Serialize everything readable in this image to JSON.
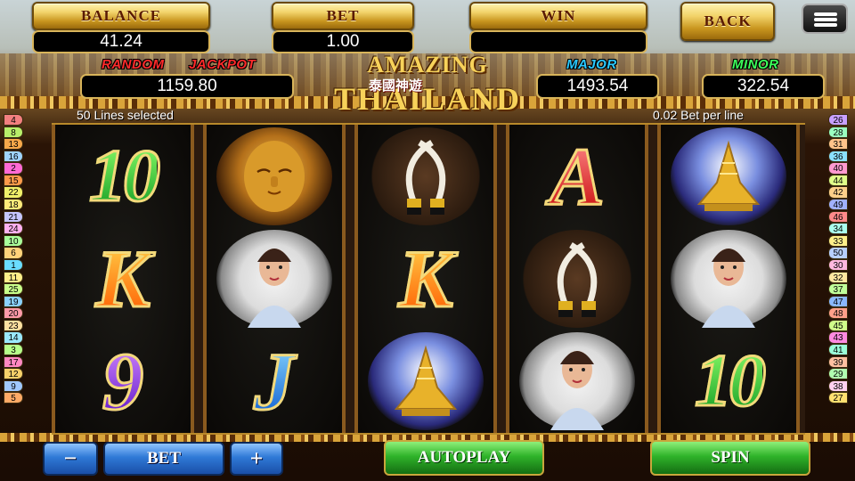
{
  "header": {
    "balance_label": "BALANCE",
    "balance_value": "41.24",
    "bet_label": "BET",
    "bet_value": "1.00",
    "win_label": "WIN",
    "win_value": "",
    "back_label": "BACK"
  },
  "jackpots": {
    "random_label_1": "RANDOM",
    "random_label_2": "JACKPOT",
    "random_value": "1159.80",
    "major_label": "MAJOR",
    "major_value": "1493.54",
    "minor_label": "MINOR",
    "minor_value": "322.54"
  },
  "title": {
    "line1": "AMAZING",
    "chinese": "泰國神遊",
    "line2": "THAILAND"
  },
  "info": {
    "lines_selected": "50 Lines selected",
    "bet_per_line": "0.02 Bet per line"
  },
  "colors": {
    "gold": "#f2d36a",
    "red_label": "#ff2a2a",
    "cyan_label": "#29c9ff",
    "green_label": "#3cff5a"
  },
  "paylines": {
    "left": [
      "4",
      "8",
      "13",
      "16",
      "2",
      "15",
      "22",
      "18",
      "21",
      "24",
      "10",
      "6",
      "1",
      "11",
      "25",
      "19",
      "20",
      "23",
      "14",
      "3",
      "17",
      "12",
      "9",
      "5"
    ],
    "right": [
      "26",
      "28",
      "31",
      "36",
      "40",
      "44",
      "42",
      "49",
      "46",
      "34",
      "33",
      "50",
      "30",
      "32",
      "37",
      "47",
      "48",
      "45",
      "43",
      "41",
      "39",
      "29",
      "38",
      "27"
    ],
    "left_colors": [
      "#f27f7f",
      "#b8ef6a",
      "#f7a84a",
      "#9fd3ff",
      "#ff6ad5",
      "#ff9a4a",
      "#f0f06a",
      "#ffe97a",
      "#c6c6ff",
      "#ffb0f0",
      "#a9ff9a",
      "#ffd27a",
      "#6adcff",
      "#ffef8a",
      "#c9ff8a",
      "#8ad1ff",
      "#ff9aa8",
      "#ffe0a0",
      "#9ae8ff",
      "#b6ff8a",
      "#ff88c2",
      "#f7d06a",
      "#a0c8ff",
      "#ffaa66"
    ],
    "right_colors": [
      "#c8a0ff",
      "#9affc0",
      "#ffc38a",
      "#8ae0ff",
      "#ff9ad0",
      "#e0ff8a",
      "#ffd08a",
      "#a0b0ff",
      "#ff8a8a",
      "#aaffee",
      "#fff08a",
      "#b8d0ff",
      "#ffb8e0",
      "#ffe8a0",
      "#c0ff9a",
      "#8ab8ff",
      "#ffa08a",
      "#d0ff8a",
      "#ff8ae0",
      "#9affd8",
      "#ffc0a0",
      "#b0ffb0",
      "#ffd0f0",
      "#ffe070"
    ]
  },
  "reels": [
    [
      "ten",
      "king",
      "nine"
    ],
    [
      "buddha",
      "dancer",
      "jack"
    ],
    [
      "tusks",
      "king",
      "pagoda"
    ],
    [
      "ace",
      "tusks",
      "dancer"
    ],
    [
      "pagoda",
      "dancer",
      "ten"
    ]
  ],
  "symbols": {
    "ten": "10",
    "king": "K",
    "nine": "9",
    "jack": "J",
    "ace": "A"
  },
  "controls": {
    "minus": "−",
    "bet": "BET",
    "plus": "+",
    "autoplay": "AUTOPLAY",
    "spin": "SPIN"
  }
}
